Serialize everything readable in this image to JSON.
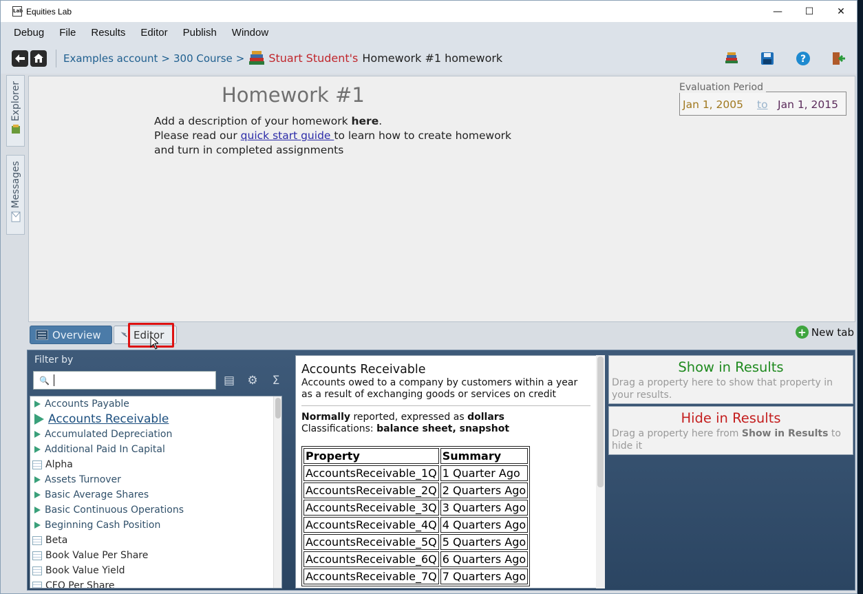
{
  "window": {
    "title": "Equities Lab",
    "app_icon_text": "Lab",
    "controls": {
      "minimize": "—",
      "maximize": "☐",
      "close": "✕"
    }
  },
  "menu": [
    "Debug",
    "File",
    "Results",
    "Editor",
    "Publish",
    "Window"
  ],
  "breadcrumb": {
    "account": "Examples account",
    "course": "300 Course",
    "separator": ">",
    "student": "Stuart Student's",
    "homework": "Homework #1 homework"
  },
  "side_tabs": [
    "Explorer",
    "Messages"
  ],
  "homework": {
    "title": "Homework #1",
    "line1_prefix": "Add a description of your homework ",
    "line1_bold": "here",
    "line1_suffix": ".",
    "line2_prefix": "Please read our ",
    "line2_link": "quick start guide ",
    "line2_suffix": "to learn how to create homework",
    "line3": "and turn in completed assignments"
  },
  "evaluation": {
    "label": "Evaluation Period",
    "from": "Jan 1, 2005",
    "to_word": "to",
    "until": "Jan 1, 2015"
  },
  "tabs": {
    "overview": "Overview",
    "editor": "Editor",
    "new_tab": "New tab"
  },
  "filter": {
    "label": "Filter by",
    "search_value": ""
  },
  "properties": [
    {
      "name": "Accounts Payable",
      "icon": "triangle"
    },
    {
      "name": "Accounts Receivable",
      "icon": "triangle",
      "selected": true
    },
    {
      "name": "Accumulated Depreciation",
      "icon": "triangle"
    },
    {
      "name": "Additional Paid In Capital",
      "icon": "triangle"
    },
    {
      "name": "Alpha",
      "icon": "grid"
    },
    {
      "name": "Assets Turnover",
      "icon": "triangle"
    },
    {
      "name": "Basic Average Shares",
      "icon": "triangle"
    },
    {
      "name": "Basic Continuous Operations",
      "icon": "triangle"
    },
    {
      "name": "Beginning Cash Position",
      "icon": "triangle"
    },
    {
      "name": "Beta",
      "icon": "grid"
    },
    {
      "name": "Book Value Per Share",
      "icon": "grid"
    },
    {
      "name": "Book Value Yield",
      "icon": "grid"
    },
    {
      "name": "CFO Per Share",
      "icon": "grid"
    }
  ],
  "detail": {
    "title": "Accounts Receivable",
    "description": "Accounts owed to a company by customers within a year as a result of exchanging goods or services on credit",
    "reported_word": "Normally",
    "reported_mid": " reported, expressed as ",
    "reported_unit": "dollars",
    "class_prefix": "Classifications: ",
    "class_value": "balance sheet, snapshot",
    "table_headers": [
      "Property",
      "Summary"
    ],
    "table_rows": [
      [
        "AccountsReceivable_1Q",
        "1 Quarter Ago"
      ],
      [
        "AccountsReceivable_2Q",
        "2 Quarters Ago"
      ],
      [
        "AccountsReceivable_3Q",
        "3 Quarters Ago"
      ],
      [
        "AccountsReceivable_4Q",
        "4 Quarters Ago"
      ],
      [
        "AccountsReceivable_5Q",
        "5 Quarters Ago"
      ],
      [
        "AccountsReceivable_6Q",
        "6 Quarters Ago"
      ],
      [
        "AccountsReceivable_7Q",
        "7 Quarters Ago"
      ]
    ]
  },
  "results": {
    "show_title": "Show in Results",
    "show_desc": "Drag a property here to show that property in your results.",
    "hide_title": "Hide in Results",
    "hide_desc_prefix": "Drag a property here from ",
    "hide_desc_bold": "Show in Results",
    "hide_desc_suffix": " to hide it"
  },
  "colors": {
    "student": "#c0262c",
    "link": "#1f5f8f",
    "show": "#1f8a1f",
    "hide": "#c41f1f",
    "highlight": "#dd1111"
  }
}
